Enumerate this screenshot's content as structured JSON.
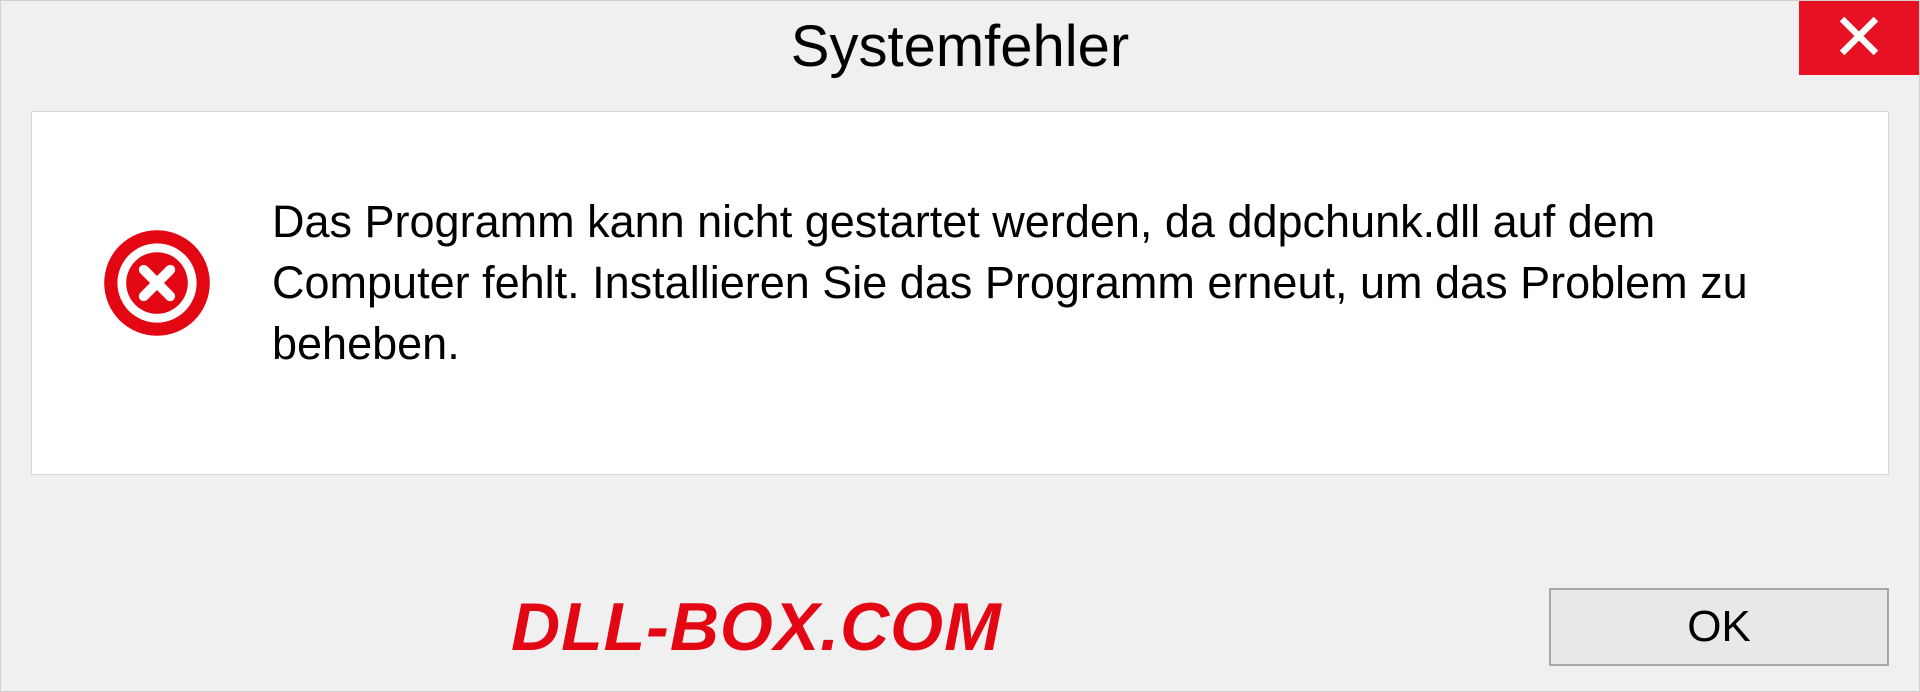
{
  "dialog": {
    "title": "Systemfehler",
    "message": "Das Programm kann nicht gestartet werden, da ddpchunk.dll auf dem Computer fehlt. Installieren Sie das Programm erneut, um das Problem zu beheben.",
    "ok_label": "OK"
  },
  "watermark": "DLL-BOX.COM",
  "colors": {
    "close_button": "#e81123",
    "error_icon": "#e30613",
    "watermark": "#e30613"
  }
}
